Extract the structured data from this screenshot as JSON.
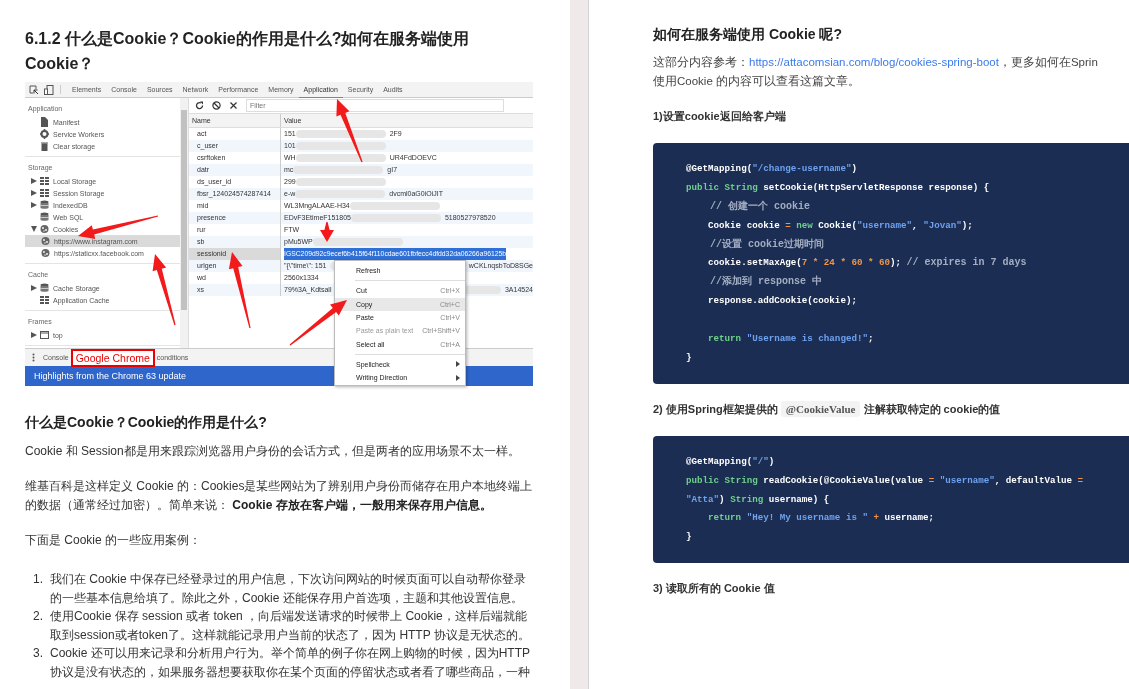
{
  "left_page": {
    "title": "6.1.2 什么是Cookie？Cookie的作用是什么?如何在服务端使用 Cookie？",
    "devtools": {
      "tabs": [
        {
          "label": "Elements",
          "selected": false
        },
        {
          "label": "Console",
          "selected": false
        },
        {
          "label": "Sources",
          "selected": false
        },
        {
          "label": "Network",
          "selected": false
        },
        {
          "label": "Performance",
          "selected": false
        },
        {
          "label": "Memory",
          "selected": false
        },
        {
          "label": "Application",
          "selected": true
        },
        {
          "label": "Security",
          "selected": false
        },
        {
          "label": "Audits",
          "selected": false
        }
      ],
      "sidebar": [
        {
          "heading": "Application",
          "items": [
            {
              "label": "Manifest",
              "kind": "file",
              "selected": false
            },
            {
              "label": "Service Workers",
              "kind": "gear",
              "selected": false
            },
            {
              "label": "Clear storage",
              "kind": "trash",
              "selected": false
            }
          ]
        },
        {
          "heading": "Storage",
          "items": [
            {
              "label": "Local Storage",
              "kind": "grid",
              "expanded": false,
              "selected": false
            },
            {
              "label": "Session Storage",
              "kind": "grid",
              "expanded": false,
              "selected": false
            },
            {
              "label": "IndexedDB",
              "kind": "db",
              "expanded": false,
              "selected": false
            },
            {
              "label": "Web SQL",
              "kind": "db",
              "selected": false
            },
            {
              "label": "Cookies",
              "kind": "cookie",
              "expanded": true,
              "selected": false,
              "children": [
                {
                  "label": "https://www.instagram.com",
                  "kind": "cookie",
                  "selected": true
                },
                {
                  "label": "https://staticxx.facebook.com",
                  "kind": "cookie",
                  "selected": false
                }
              ]
            }
          ]
        },
        {
          "heading": "Cache",
          "items": [
            {
              "label": "Cache Storage",
              "kind": "db",
              "expanded": false,
              "selected": false
            },
            {
              "label": "Application Cache",
              "kind": "grid",
              "selected": false
            }
          ]
        },
        {
          "heading": "Frames",
          "items": [
            {
              "label": "top",
              "kind": "frame",
              "expanded": false,
              "selected": false
            }
          ]
        }
      ],
      "filter": {
        "placeholder": "Filter"
      },
      "columns": [
        "Name",
        "Value"
      ],
      "rows": [
        {
          "name": "act",
          "value": "151",
          "redacted": true,
          "value_tail": "2F9",
          "selected": false
        },
        {
          "name": "c_user",
          "value": "101",
          "redacted": true,
          "selected": false
        },
        {
          "name": "csrftoken",
          "value": "WH",
          "redacted": true,
          "value_tail": "UR4FdDOEVC",
          "selected": false
        },
        {
          "name": "datr",
          "value": "mc",
          "redacted": true,
          "value_tail": "gI7",
          "selected": false
        },
        {
          "name": "ds_user_id",
          "value": "299",
          "redacted": true,
          "selected": false
        },
        {
          "name": "fbsr_124024574287414",
          "value": "e-w",
          "redacted": true,
          "value_tail": "dvcml0aG0iOiJIT",
          "selected": false
        },
        {
          "name": "mid",
          "value": "WL3MngALAAE-H34",
          "redacted": true,
          "selected": false
        },
        {
          "name": "presence",
          "value": "EDvF3EtimeF151805",
          "redacted": true,
          "value_tail": "5180527978520",
          "selected": false
        },
        {
          "name": "rur",
          "value": "FTW",
          "selected": false
        },
        {
          "name": "sb",
          "value": "pMu5WP",
          "redacted": true,
          "selected": false
        },
        {
          "name": "sessionid",
          "value": "IGSC209d92c9ecef6b415f64f110cdae601fbfecc4dfdd32da06266a96125b",
          "selected": true
        },
        {
          "name": "urlgen",
          "value": "\"{\\\"time\\\": 151",
          "redacted": true,
          "value_tail": "wCKLnqsbToD8SGe",
          "selected": false
        },
        {
          "name": "wd",
          "value": "2560x1334",
          "selected": false
        },
        {
          "name": "xs",
          "value": "79%3A_Kdtsall",
          "redacted": true,
          "value_tail": "3A14524",
          "selected": false
        }
      ],
      "context_menu": [
        {
          "kind": "item",
          "label": "Refresh",
          "selected": false,
          "disabled": false
        },
        {
          "kind": "separator"
        },
        {
          "kind": "item",
          "label": "Cut",
          "shortcut": "Ctrl+X",
          "selected": false,
          "disabled": false
        },
        {
          "kind": "item",
          "label": "Copy",
          "shortcut": "Ctrl+C",
          "selected": true,
          "disabled": false
        },
        {
          "kind": "item",
          "label": "Paste",
          "shortcut": "Ctrl+V",
          "selected": false,
          "disabled": false
        },
        {
          "kind": "item",
          "label": "Paste as plain text",
          "shortcut": "Ctrl+Shift+V",
          "selected": false,
          "disabled": true
        },
        {
          "kind": "item",
          "label": "Select all",
          "shortcut": "Ctrl+A",
          "selected": false,
          "disabled": false
        },
        {
          "kind": "separator"
        },
        {
          "kind": "item",
          "label": "Spellcheck",
          "submenu": true,
          "selected": false,
          "disabled": false
        },
        {
          "kind": "item",
          "label": "Writing Direction",
          "submenu": true,
          "selected": false,
          "disabled": false
        }
      ],
      "drawer": {
        "tab": "Console",
        "callout": "Google Chrome",
        "tab_end": "conditions"
      },
      "banner": "Highlights from the Chrome 63 update"
    },
    "section_title": "什么是Cookie？Cookie的作用是什么?",
    "paragraphs": [
      "Cookie 和 Session都是用来跟踪浏览器用户身份的会话方式，但是两者的应用场景不太一样。",
      "维基百科是这样定义 Cookie 的：Cookies是某些网站为了辨别用户身份而储存在用户本地终端上的数据（通常经过加密）。简单来说： **Cookie 存放在客户端，一般用来保存用户信息。**",
      "下面是 Cookie 的一些应用案例："
    ],
    "list": [
      {
        "number": "1.",
        "text": "我们在 Cookie 中保存已经登录过的用户信息，下次访问网站的时候页面可以自动帮你登录的一些基本信息给填了。除此之外，Cookie 还能保存用户首选项，主题和其他设置信息。"
      },
      {
        "number": "2.",
        "text": "使用Cookie 保存 session 或者 token ，向后端发送请求的时候带上 Cookie，这样后端就能取到session或者token了。这样就能记录用户当前的状态了，因为 HTTP 协议是无状态的。"
      },
      {
        "number": "3.",
        "text": "Cookie 还可以用来记录和分析用户行为。举个简单的例子你在网上购物的时候，因为HTTP协议是没有状态的，如果服务器想要获取你在某个页面的停留状态或者看了哪些商品，一种"
      }
    ]
  },
  "right_page": {
    "title": "如何在服务端使用 Cookie 呢?",
    "intro": {
      "prefix": "这部分内容参考：",
      "link": "https://attacomsian.com/blog/cookies-spring-boot",
      "suffix": "，更多如何在Sprin",
      "line2": "使用Cookie 的内容可以查看这篇文章。"
    },
    "sections": [
      {
        "heading": {
          "text": "1)设置cookie返回给客户端"
        },
        "code": [
          {
            "tokens": [
              {
                "t": "@GetMapping(",
                "kind": "plain"
              },
              {
                "t": "\"/change-username\"",
                "kind": "str"
              },
              {
                "t": ")",
                "kind": "plain"
              }
            ]
          },
          {
            "tokens": [
              {
                "t": "public ",
                "kind": "kw"
              },
              {
                "t": "String ",
                "kind": "kw"
              },
              {
                "t": "setCookie(HttpServletResponse response) {",
                "kind": "plain"
              }
            ]
          },
          {
            "tokens": [
              {
                "t": "    // 创建一个 cookie",
                "kind": "com"
              }
            ]
          },
          {
            "tokens": [
              {
                "t": "    Cookie cookie ",
                "kind": "plain"
              },
              {
                "t": "= ",
                "kind": "num"
              },
              {
                "t": "new ",
                "kind": "kw"
              },
              {
                "t": "Cookie(",
                "kind": "plain"
              },
              {
                "t": "\"username\"",
                "kind": "str"
              },
              {
                "t": ", ",
                "kind": "plain"
              },
              {
                "t": "\"Jovan\"",
                "kind": "str"
              },
              {
                "t": ");",
                "kind": "plain"
              }
            ]
          },
          {
            "tokens": [
              {
                "t": "    //设置 cookie过期时间",
                "kind": "com"
              }
            ]
          },
          {
            "tokens": [
              {
                "t": "    cookie.setMaxAge(",
                "kind": "plain"
              },
              {
                "t": "7 * 24 * 60 * 60",
                "kind": "num"
              },
              {
                "t": "); ",
                "kind": "plain"
              },
              {
                "t": "// expires in 7 days",
                "kind": "com"
              }
            ]
          },
          {
            "tokens": [
              {
                "t": "    //添加到 response 中",
                "kind": "com"
              }
            ]
          },
          {
            "tokens": [
              {
                "t": "    response.addCookie(cookie);",
                "kind": "plain"
              }
            ]
          },
          {
            "space_before": true,
            "tokens": [
              {
                "t": "    return ",
                "kind": "kw"
              },
              {
                "t": "\"Username is changed!\"",
                "kind": "str"
              },
              {
                "t": ";",
                "kind": "plain"
              }
            ]
          },
          {
            "tokens": [
              {
                "t": "}",
                "kind": "plain"
              }
            ]
          }
        ]
      },
      {
        "heading": {
          "text": "2) 使用Spring框架提供的 ",
          "code": "@CookieValue",
          "after": " 注解获取特定的 cookie的值"
        },
        "code": [
          {
            "tokens": [
              {
                "t": "@GetMapping(",
                "kind": "plain"
              },
              {
                "t": "\"/\"",
                "kind": "str"
              },
              {
                "t": ")",
                "kind": "plain"
              }
            ]
          },
          {
            "tokens": [
              {
                "t": "public ",
                "kind": "kw"
              },
              {
                "t": "String ",
                "kind": "kw"
              },
              {
                "t": "readCookie(@CookieValue(value ",
                "kind": "plain"
              },
              {
                "t": "= ",
                "kind": "num"
              },
              {
                "t": "\"username\"",
                "kind": "str"
              },
              {
                "t": ", defaultValue ",
                "kind": "plain"
              },
              {
                "t": "=",
                "kind": "num"
              }
            ]
          },
          {
            "tokens": [
              {
                "t": "\"Atta\"",
                "kind": "str"
              },
              {
                "t": ") ",
                "kind": "plain"
              },
              {
                "t": "String ",
                "kind": "kw"
              },
              {
                "t": "username) {",
                "kind": "plain"
              }
            ]
          },
          {
            "tokens": [
              {
                "t": "    return ",
                "kind": "kw"
              },
              {
                "t": "\"Hey! My username is \" ",
                "kind": "str"
              },
              {
                "t": "+ ",
                "kind": "num"
              },
              {
                "t": "username;",
                "kind": "plain"
              }
            ]
          },
          {
            "tokens": [
              {
                "t": "}",
                "kind": "plain"
              }
            ]
          }
        ]
      },
      {
        "heading": {
          "text": "3) 读取所有的 Cookie 值"
        }
      }
    ]
  }
}
